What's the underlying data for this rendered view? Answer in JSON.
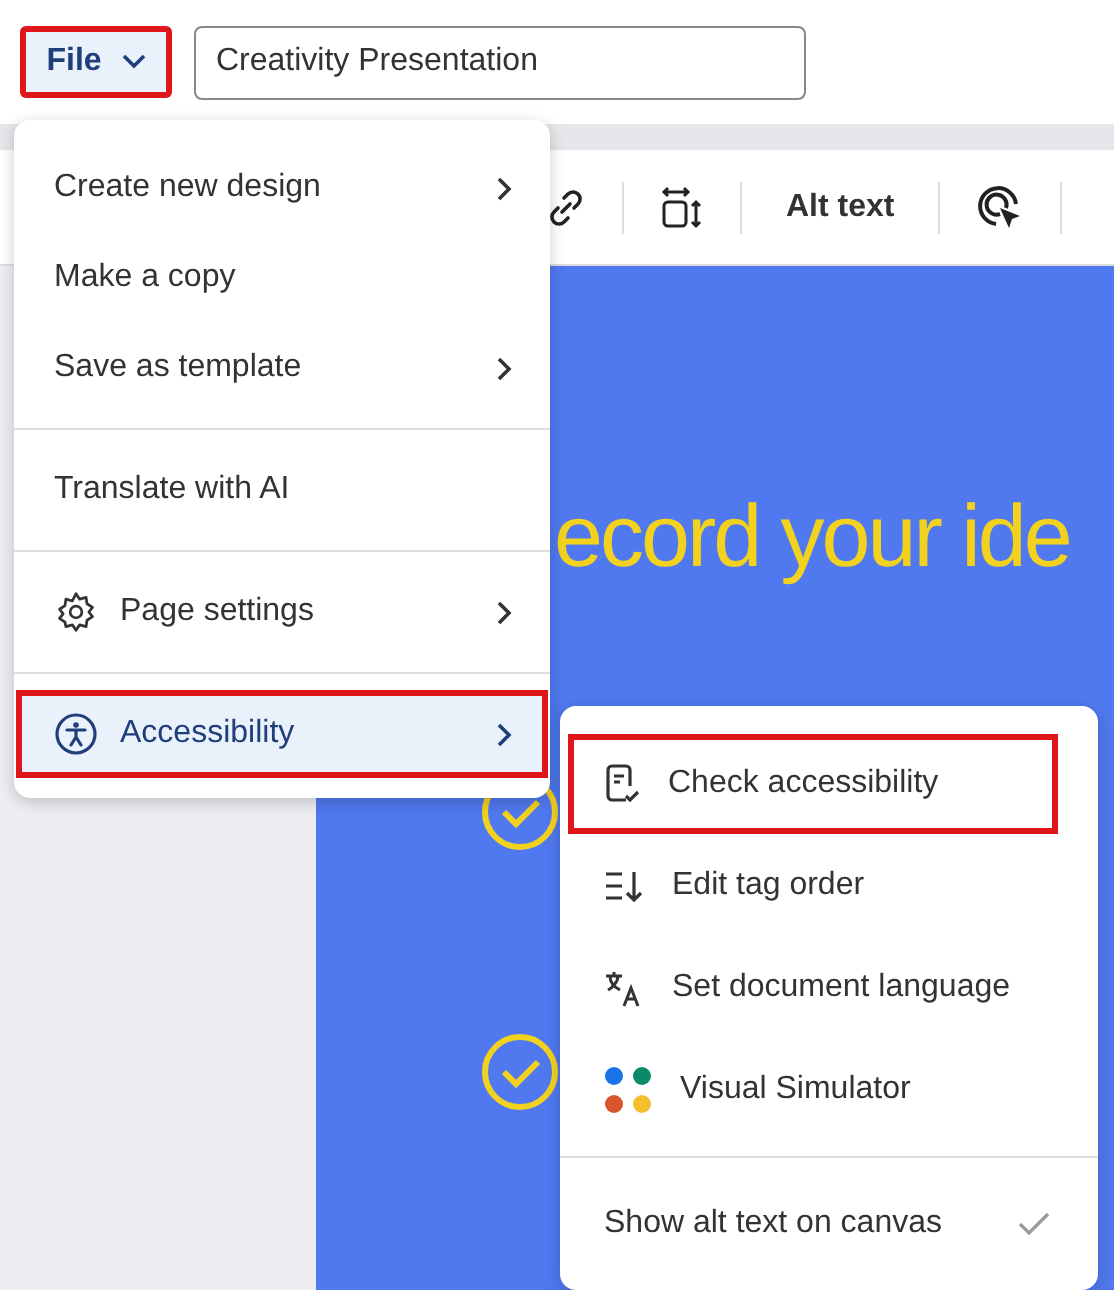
{
  "file_button": {
    "label": "File",
    "highlighted": true
  },
  "title_field": {
    "value": "Creativity Presentation"
  },
  "toolbar": {
    "items": [
      {
        "kind": "link"
      },
      {
        "kind": "resize"
      },
      {
        "kind": "text",
        "label": "Alt text"
      },
      {
        "kind": "cursor"
      }
    ]
  },
  "slide": {
    "headline": "ecord your ide"
  },
  "file_menu": {
    "groups": [
      [
        {
          "label": "Create new design",
          "kind": "plain",
          "submenu": true,
          "selected": false,
          "highlighted": false
        },
        {
          "label": "Make a copy",
          "kind": "plain",
          "submenu": false,
          "selected": false,
          "highlighted": false
        },
        {
          "label": "Save as template",
          "kind": "plain",
          "submenu": true,
          "selected": false,
          "highlighted": false
        }
      ],
      [
        {
          "label": "Translate with AI",
          "kind": "plain",
          "submenu": false,
          "selected": false,
          "highlighted": false
        }
      ],
      [
        {
          "label": "Page settings",
          "kind": "settings",
          "submenu": true,
          "selected": false,
          "highlighted": false
        }
      ],
      [
        {
          "label": "Accessibility",
          "kind": "accessibility",
          "submenu": true,
          "selected": true,
          "highlighted": true
        }
      ]
    ]
  },
  "accessibility_submenu": {
    "groups": [
      [
        {
          "label": "Check accessibility",
          "kind": "check-doc",
          "highlighted": true
        },
        {
          "label": "Edit tag order",
          "kind": "tag-order",
          "highlighted": false
        },
        {
          "label": "Set document language",
          "kind": "language",
          "highlighted": false
        },
        {
          "label": "Visual Simulator",
          "kind": "simulator",
          "highlighted": false
        }
      ],
      [
        {
          "label": "Show alt text on canvas",
          "kind": "toggle",
          "checked": true,
          "highlighted": false
        }
      ]
    ]
  }
}
